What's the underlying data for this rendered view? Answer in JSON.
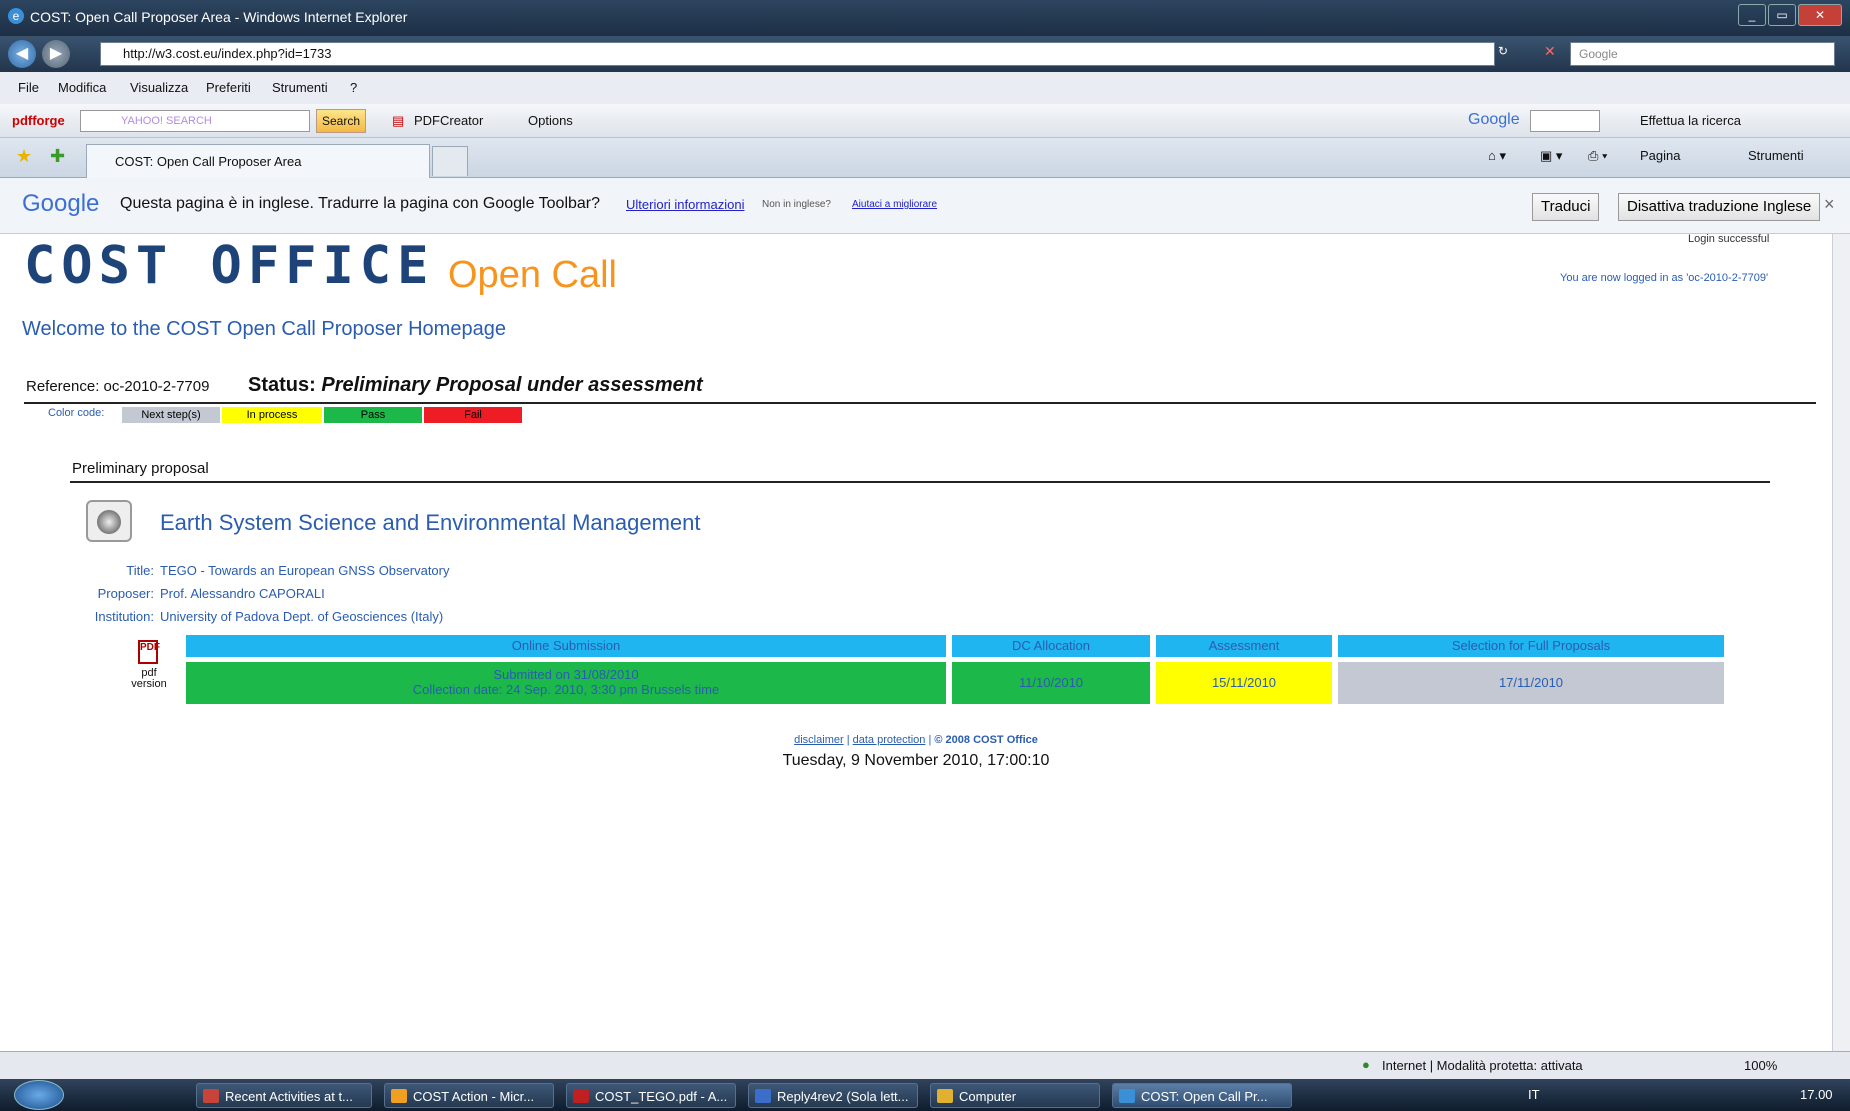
{
  "window": {
    "title": "COST: Open Call Proposer Area - Windows Internet Explorer"
  },
  "address": {
    "url": "http://w3.cost.eu/index.php?id=1733",
    "search_placeholder": "Google"
  },
  "menu": [
    "File",
    "Modifica",
    "Visualizza",
    "Preferiti",
    "Strumenti",
    "?"
  ],
  "toolbar": {
    "pdfforge": "pdfforge",
    "yahoo": "YAHOO! SEARCH",
    "search": "Search",
    "pdfcreator": "PDFCreator",
    "options": "Options",
    "google": "Google",
    "effettua": "Effettua la ricerca",
    "pagina": "Pagina",
    "strumenti": "Strumenti"
  },
  "tab": {
    "label": "COST: Open Call Proposer Area"
  },
  "google_translate": {
    "brand": "Google",
    "message": "Questa pagina è in inglese. Tradurre la pagina con Google Toolbar?",
    "more_info": "Ulteriori informazioni",
    "not_english": "Non in inglese?",
    "help": "Aiutaci a migliorare",
    "translate_button": "Traduci",
    "disable_button": "Disattiva traduzione Inglese",
    "close": "×"
  },
  "page": {
    "logo": "COST OFFICE",
    "open_call": "Open Call",
    "login_successful": "Login successful",
    "logged_in_as": "You are now logged in as 'oc-2010-2-7709'",
    "welcome": "Welcome to the COST Open Call Proposer Homepage",
    "reference": "Reference: oc-2010-2-7709",
    "status_label": "Status:",
    "status_value": "Preliminary Proposal under assessment",
    "color_code_label": "Color code:",
    "color_codes": [
      {
        "label": "Next step(s)",
        "color": "#c4c8d2"
      },
      {
        "label": "In process",
        "color": "#ffff00"
      },
      {
        "label": "Pass",
        "color": "#1cb84a"
      },
      {
        "label": "Fail",
        "color": "#ee1c24"
      }
    ],
    "section": "Preliminary proposal",
    "domain": "Earth System Science and Environmental Management",
    "info": [
      {
        "label": "Title:",
        "value": "TEGO - Towards an European GNSS Observatory"
      },
      {
        "label": "Proposer:",
        "value": "Prof. Alessandro CAPORALI"
      },
      {
        "label": "Institution:",
        "value": "University of Padova Dept. of Geosciences (Italy)"
      }
    ],
    "pdf_label": "pdf version",
    "stages": [
      {
        "header": "Online Submission",
        "line1": "Submitted on 31/08/2010",
        "line2": "Collection date: 24 Sep. 2010, 3:30 pm Brussels time",
        "color": "#1cb84a"
      },
      {
        "header": "DC Allocation",
        "line1": "11/10/2010",
        "line2": "",
        "color": "#1cb84a"
      },
      {
        "header": "Assessment",
        "line1": "15/11/2010",
        "line2": "",
        "color": "#ffff00"
      },
      {
        "header": "Selection for Full Proposals",
        "line1": "17/11/2010",
        "line2": "",
        "color": "#c4c8d2"
      }
    ],
    "footer": {
      "disclaimer": "disclaimer",
      "data_protection": "data protection",
      "copyright": "© 2008 COST Office"
    },
    "datetime": "Tuesday, 9 November 2010, 17:00:10"
  },
  "statusbar": {
    "zone": "Internet | Modalità protetta: attivata",
    "zoom": "100%"
  },
  "taskbar": {
    "items": [
      "Recent Activities at t...",
      "COST Action - Micr...",
      "COST_TEGO.pdf - A...",
      "Reply4rev2 (Sola lett...",
      "Computer",
      "COST: Open Call Pr..."
    ],
    "lang": "IT",
    "clock": "17.00"
  }
}
